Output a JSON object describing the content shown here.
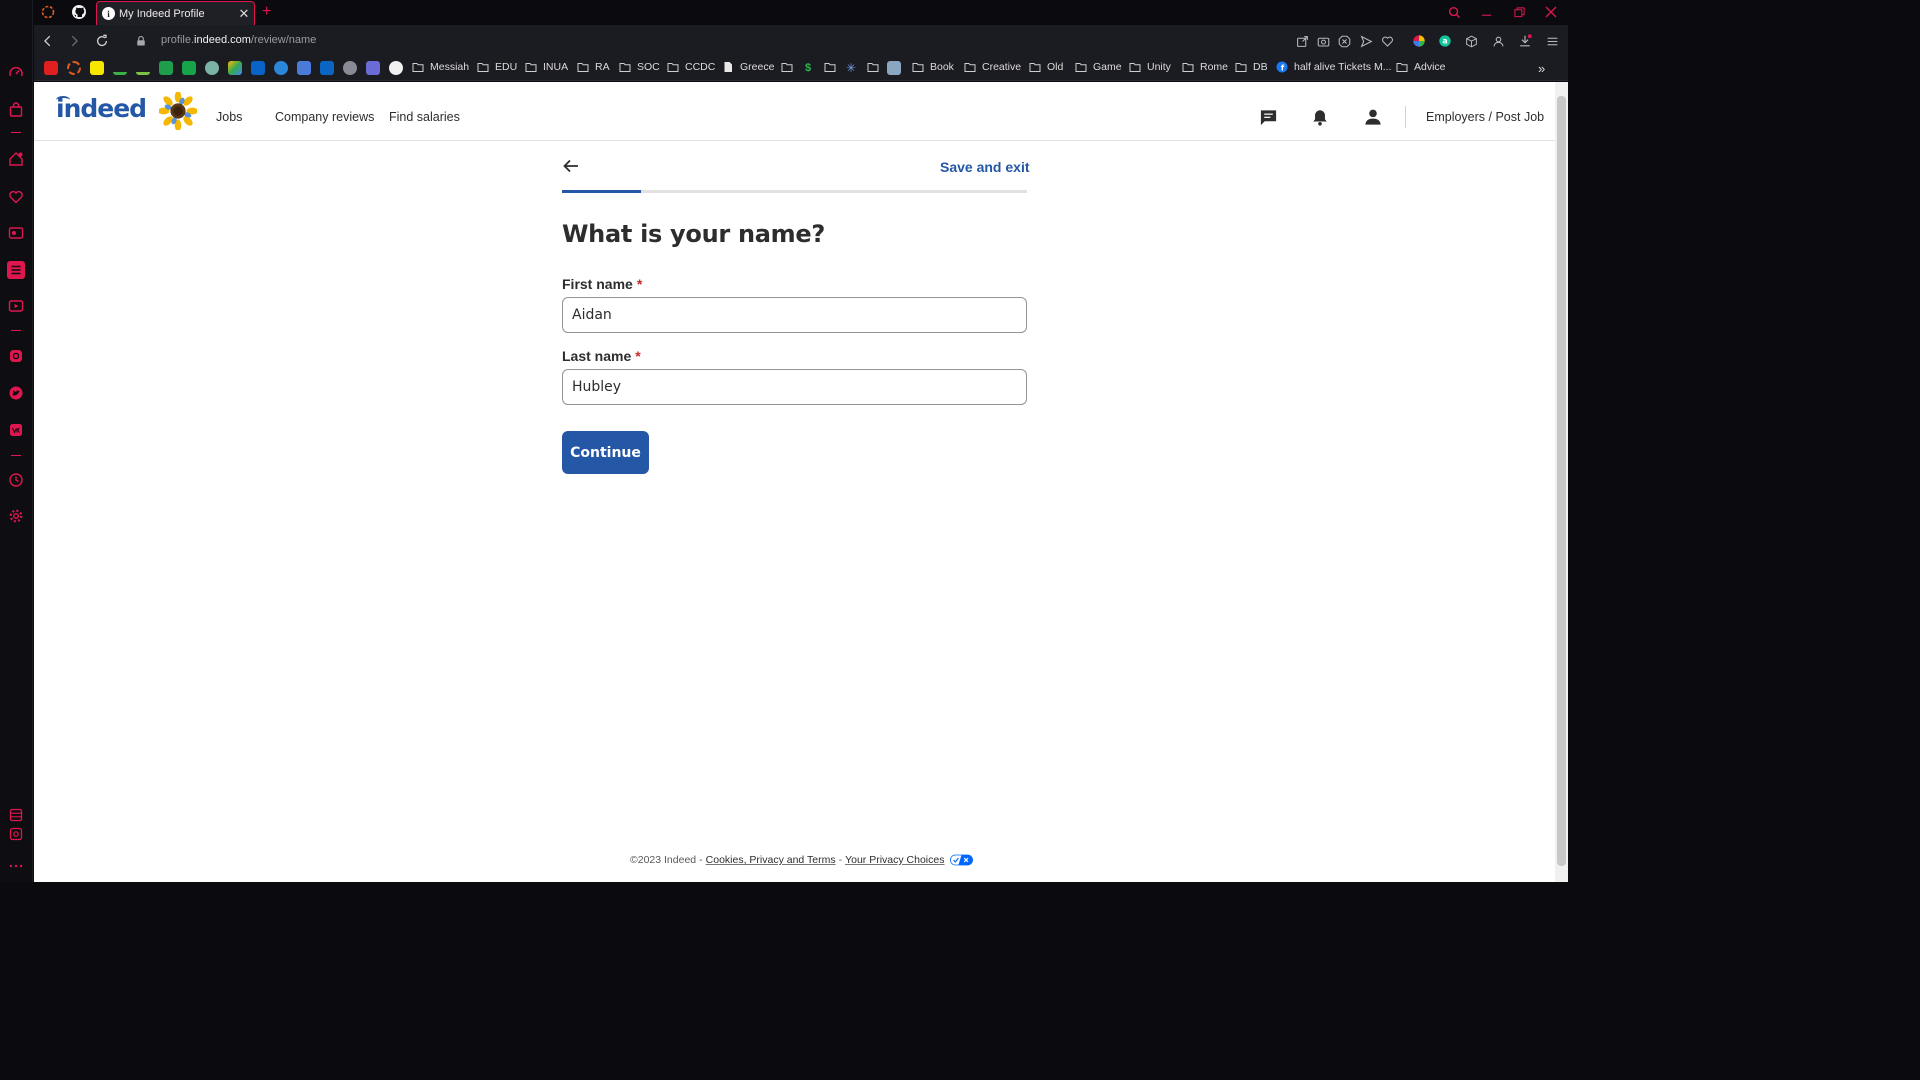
{
  "browser": {
    "tab_title": "My Indeed Profile",
    "tab_favicon_letter": "i",
    "new_tab_label": "+",
    "url_prefix": "profile.",
    "url_domain": "indeed.com",
    "url_path": "/review/name",
    "accent_color": "#e0164e",
    "bookmarks": [
      "Messiah",
      "EDU",
      "INUA",
      "RA",
      "SOC",
      "CCDC",
      "Greece",
      "Book",
      "Creative",
      "Old",
      "Game",
      "Unity",
      "Rome",
      "DB",
      "half alive Tickets M...",
      "Advice"
    ],
    "more_bookmarks": "»"
  },
  "site": {
    "logo_text": "indeed",
    "brand_color": "#2557a7",
    "nav": {
      "jobs": "Jobs",
      "company_reviews": "Company reviews",
      "find_salaries": "Find salaries",
      "employers": "Employers / Post Job"
    },
    "icons": [
      "messages-icon",
      "notifications-bell-icon",
      "profile-person-icon"
    ]
  },
  "form": {
    "save_exit": "Save and exit",
    "progress": 0.17,
    "title": "What is your name?",
    "first_name_label": "First name",
    "first_name_value": "Aidan",
    "last_name_label": "Last name",
    "last_name_value": "Hubley",
    "required_mark": "*",
    "continue_label": "Continue"
  },
  "footer": {
    "copyright": "©2023 Indeed",
    "separator": "-",
    "cookies_link": "Cookies, Privacy and Terms",
    "privacy_choices_link": "Your Privacy Choices"
  }
}
